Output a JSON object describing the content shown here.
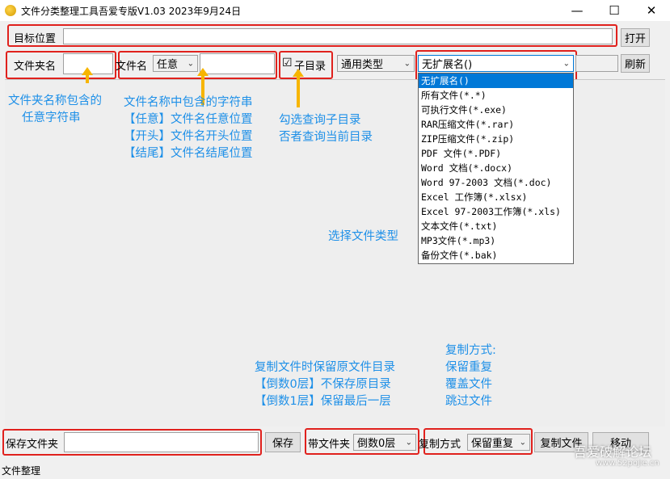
{
  "window": {
    "title": "文件分类整理工具吾爱专版V1.03  2023年9月24日",
    "minimize": "—",
    "maximize": "☐",
    "close": "✕"
  },
  "row1": {
    "target_label": "目标位置",
    "target_value": "",
    "open_button": "打开"
  },
  "row2": {
    "folder_label": "文件夹名",
    "folder_value": "",
    "filename_label": "文件名",
    "match_mode": "任意",
    "filename_value": "",
    "subdir_checkbox": "☑",
    "subdir_label": "子目录",
    "type_category": "通用类型",
    "ext_selected": "无扩展名()",
    "refresh_button": "刷新"
  },
  "ext_options": [
    "无扩展名()",
    "所有文件(*.*)",
    "可执行文件(*.exe)",
    "RAR压缩文件(*.rar)",
    "ZIP压缩文件(*.zip)",
    "PDF 文件(*.PDF)",
    "Word 文档(*.docx)",
    "Word 97-2003 文档(*.doc)",
    "Excel 工作簿(*.xlsx)",
    "Excel 97-2003工作簿(*.xls)",
    "文本文件(*.txt)",
    "MP3文件(*.mp3)",
    "备份文件(*.bak)"
  ],
  "notes": {
    "folder_note": [
      "文件夹名称包含的",
      "任意字符串"
    ],
    "filename_note": [
      "文件名称中包含的字符串",
      "【任意】文件名任意位置",
      "【开头】文件名开头位置",
      "【结尾】文件名结尾位置"
    ],
    "subdir_note": [
      "勾选查询子目录",
      "否者查询当前目录"
    ],
    "type_note": "选择文件类型",
    "keep_dir_note": [
      "复制文件时保留原文件目录",
      "【倒数0层】不保存原目录",
      "【倒数1层】保留最后一层"
    ],
    "copy_mode_note": [
      "复制方式:",
      "保留重复",
      "覆盖文件",
      "跳过文件"
    ]
  },
  "bottom": {
    "save_label": "保存文件夹",
    "save_value": "",
    "save_button": "保存",
    "with_folder_label": "带文件夹",
    "with_folder_value": "倒数0层",
    "copy_mode_label": "复制方式",
    "copy_mode_value": "保留重复",
    "copy_button": "复制文件",
    "move_button": "移动"
  },
  "status": "文件整理",
  "watermark": {
    "line1": "吾爱破解论坛",
    "line2": "www.52pojie.cn"
  },
  "colors": {
    "highlight_red": "#e0211d",
    "note_blue": "#1e90e8",
    "arrow_yellow": "#f7b500",
    "selection_blue": "#0078d7"
  }
}
